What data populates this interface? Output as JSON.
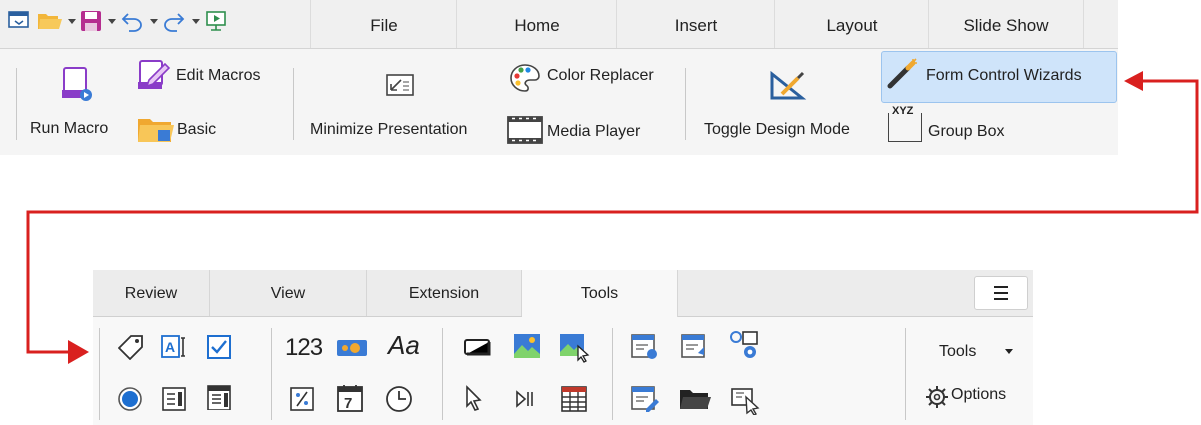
{
  "top_ribbon": {
    "tabs": [
      "File",
      "Home",
      "Insert",
      "Layout",
      "Slide Show"
    ],
    "tools": {
      "run_macro": "Run Macro",
      "edit_macros": "Edit Macros",
      "basic": "Basic",
      "minimize_presentation": "Minimize Presentation",
      "color_replacer": "Color Replacer",
      "media_player": "Media Player",
      "toggle_design_mode": "Toggle Design Mode",
      "form_control_wizards": "Form Control Wizards",
      "group_box": "Group Box",
      "group_box_icon_text": "XYZ"
    }
  },
  "bottom_ribbon": {
    "tabs": [
      "Review",
      "View",
      "Extension",
      "Tools"
    ],
    "active_tab": "Tools",
    "numeric_icon_text": "123",
    "text_icon_text": "Aa",
    "date_icon_text": "7",
    "tools_dropdown": "Tools",
    "options": "Options"
  },
  "colors": {
    "highlight": "#cfe4fa",
    "arrow": "#d9201f",
    "accent_blue": "#1e6fd0",
    "purple": "#8a3cc8"
  }
}
